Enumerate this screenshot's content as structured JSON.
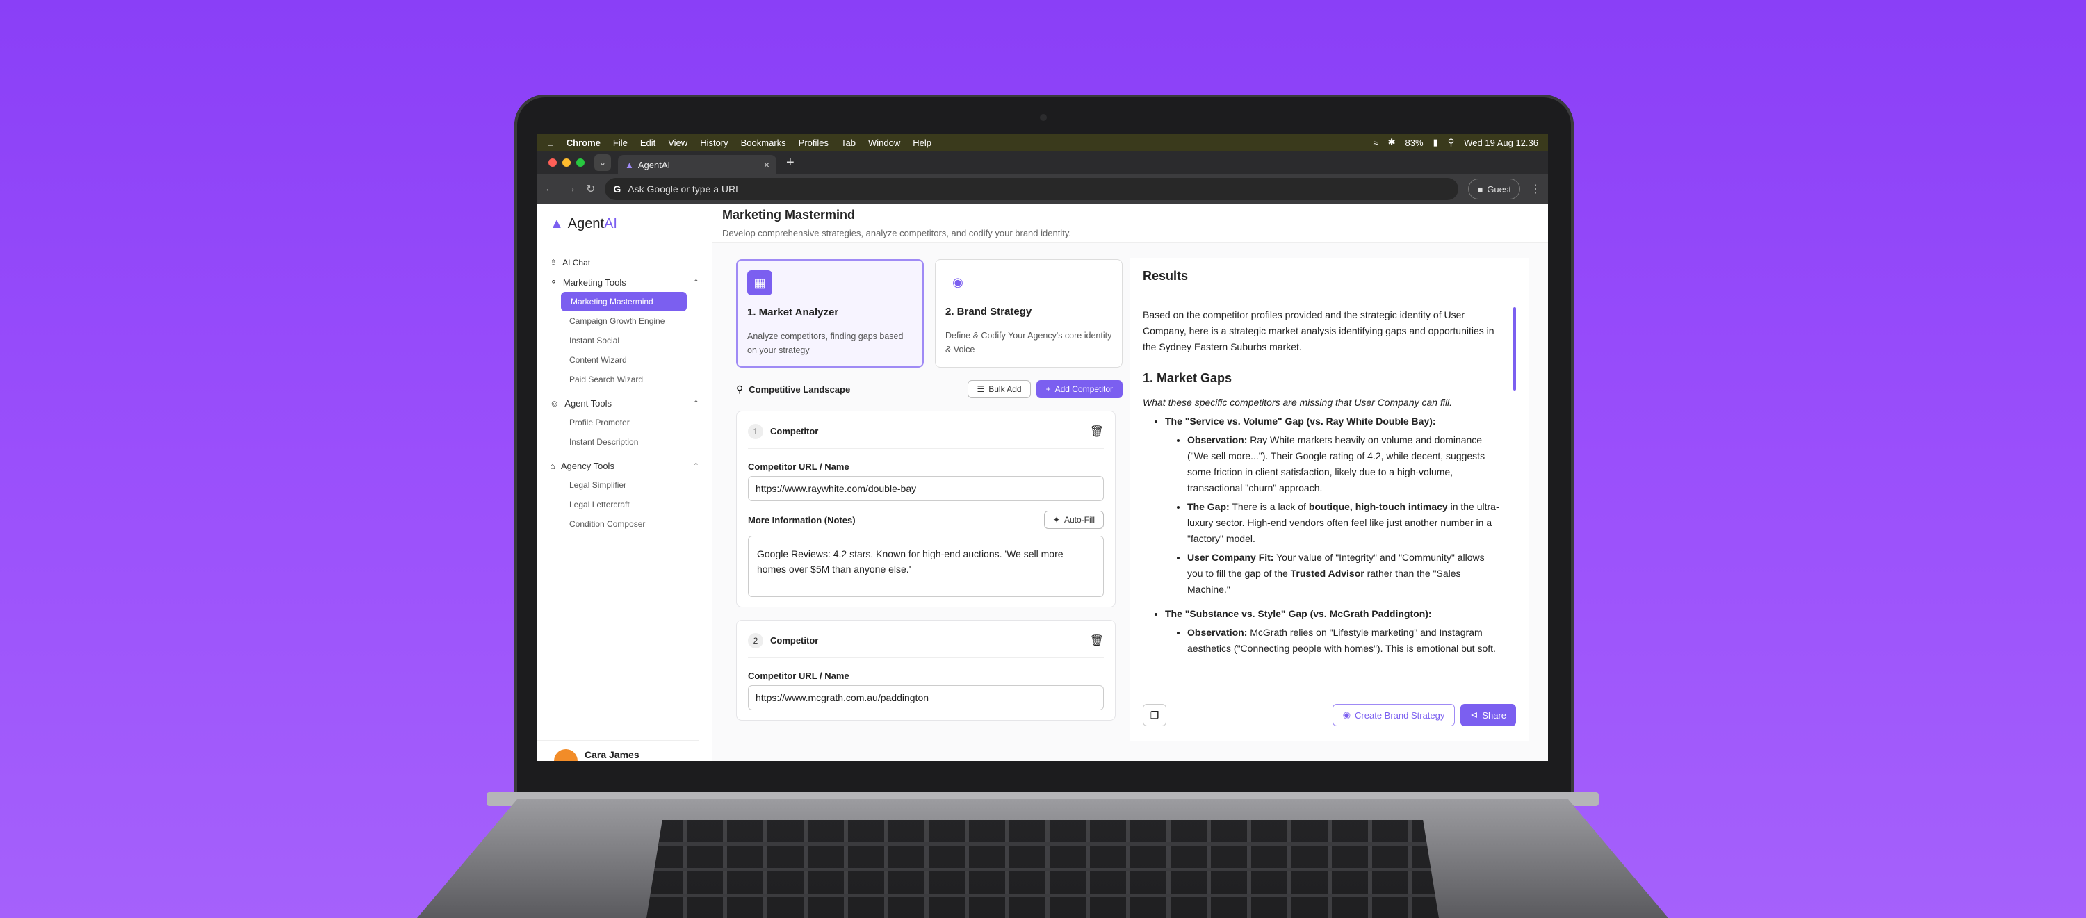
{
  "menubar": {
    "app": "Chrome",
    "items": [
      "File",
      "Edit",
      "View",
      "History",
      "Bookmarks",
      "Profiles",
      "Tab",
      "Window",
      "Help"
    ],
    "battery": "83%",
    "datetime": "Wed 19 Aug  12.36"
  },
  "browser": {
    "tab_title": "AgentAI",
    "omnibox_placeholder": "Ask Google or type a URL",
    "profile": "Guest"
  },
  "sidebar": {
    "logo_main": "Agent",
    "logo_ai": "AI",
    "top_item": "AI Chat",
    "groups": [
      {
        "label": "Marketing Tools",
        "items": [
          "Marketing Mastermind",
          "Campaign Growth Engine",
          "Instant Social",
          "Content Wizard",
          "Paid Search Wizard"
        ]
      },
      {
        "label": "Agent Tools",
        "items": [
          "Profile Promoter",
          "Instant Description"
        ]
      },
      {
        "label": "Agency Tools",
        "items": [
          "Legal Simplifier",
          "Legal Lettercraft",
          "Condition Composer"
        ]
      }
    ],
    "user_name": "Cara James"
  },
  "header": {
    "title": "Marketing Mastermind",
    "subtitle": "Develop comprehensive strategies, analyze competitors, and codify your brand identity."
  },
  "cards": [
    {
      "title": "1. Market Analyzer",
      "desc": "Analyze competitors, finding gaps based on your strategy"
    },
    {
      "title": "2. Brand Strategy",
      "desc": "Define & Codify Your Agency's core identity & Voice"
    }
  ],
  "landscape": {
    "title": "Competitive Landscape",
    "bulk_add": "Bulk Add",
    "add_competitor": "Add Competitor"
  },
  "competitors": [
    {
      "num": "1",
      "label": "Competitor",
      "url_label": "Competitor URL / Name",
      "url": "https://www.raywhite.com/double-bay",
      "notes_label": "More Information (Notes)",
      "autofill": "Auto-Fill",
      "notes": "Google Reviews: 4.2 stars. Known for high-end auctions. 'We sell more homes over $5M than anyone else.'"
    },
    {
      "num": "2",
      "label": "Competitor",
      "url_label": "Competitor URL / Name",
      "url": "https://www.mcgrath.com.au/paddington"
    }
  ],
  "results": {
    "title": "Results",
    "intro": "Based on the competitor profiles provided and the strategic identity of User Company, here is a strategic market analysis identifying gaps and opportunities in the Sydney Eastern Suburbs market.",
    "section_title": "1. Market Gaps",
    "section_lead": "What these specific competitors are missing that User Company can fill.",
    "gap1_title": "The \"Service vs. Volume\" Gap (vs. Ray White Double Bay):",
    "obs_label": "Observation:",
    "gap1_obs": " Ray White markets heavily on volume and dominance (\"We sell more...\"). Their Google rating of 4.2, while decent, suggests some friction in client satisfaction, likely due to a high-volume, transactional \"churn\" approach.",
    "gap_label": "The Gap:",
    "gap1_gap_a": " There is a lack of ",
    "gap1_gap_b": "boutique, high-touch intimacy",
    "gap1_gap_c": " in the ultra-luxury sector. High-end vendors often feel like just another number in a \"factory\" model.",
    "fit_label": "User Company Fit:",
    "gap1_fit_a": " Your value of \"Integrity\" and \"Community\" allows you to fill the gap of the ",
    "gap1_fit_b": "Trusted Advisor",
    "gap1_fit_c": " rather than the \"Sales Machine.\"",
    "gap2_title": "The \"Substance vs. Style\" Gap (vs. McGrath Paddington):",
    "gap2_obs": " McGrath relies on \"Lifestyle marketing\" and Instagram aesthetics (\"Connecting people with homes\"). This is emotional but soft.",
    "create_brand": "Create Brand Strategy",
    "share": "Share"
  }
}
